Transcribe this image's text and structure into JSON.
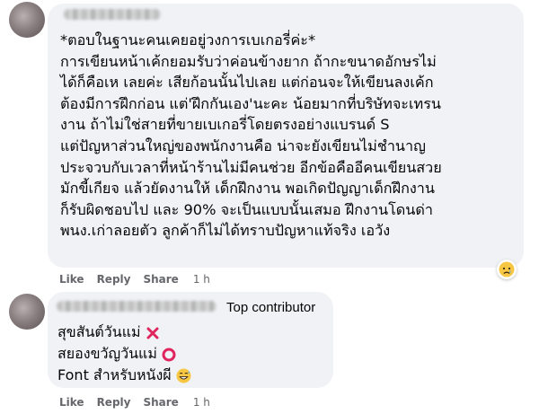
{
  "comment1": {
    "text_lines": [
      "*ตอบในฐานะคนเคยอยู่วงการเบเกอรี่ค่ะ*",
      "การเขียนหน้าเค้กยอมรับว่าค่อนข้างยาก ถ้ากะขนาดอักษรไม่",
      "ได้ก็คือเห เลยค่ะ เสียก้อนนั้นไปเลย แต่ก่อนจะให้เขียนลงเค้ก",
      "ต้องมีการฝึกก่อน แต่'ฝึกกันเอง'นะคะ น้อยมากที่บริษัทจะเทรน",
      "งาน ถ้าไม่ใช่สายที่ขายเบเกอรี่โดยตรงอย่างแบรนด์ S",
      "แต่ปัญหาส่วนใหญ่ของพนักงานคือ น่าจะยังเขียนไม่ชำนาญ",
      "ประจวบกับเวลาที่หน้าร้านไม่มีคนช่วย อีกข้อคืออีคนเขียนสวย",
      "มักขี้เกียจ แล้วยัดงานให้ เด็กฝึกงาน พอเกิดปัญญาเด็กฝึกงาน",
      "ก็รับผิดชอบไป และ 90% จะเป็นแบบนั้นเสมอ ฝึกงานโดนด่า",
      "พนง.เก่าลอยตัว ลูกค้าก็ไม่ได้ทราบปัญหาแท้จริง เอวัง"
    ],
    "actions": {
      "like": "Like",
      "reply": "Reply",
      "share": "Share",
      "time": "1 h"
    },
    "reaction_icon": "sad-crying-emoji"
  },
  "comment2": {
    "badge": "Top contributor",
    "lines": [
      {
        "text": "สุขสันต์วันแม่",
        "icon": "red-x-mark",
        "color": "#e0245e"
      },
      {
        "text": "สยองขวัญวันแม่",
        "icon": "red-circle",
        "color": "#e0245e"
      },
      {
        "text": "Font สำหรับหนังผี",
        "icon": "grinning-sweat-emoji",
        "color": "#f7c744"
      }
    ],
    "actions": {
      "like": "Like",
      "reply": "Reply",
      "share": "Share",
      "time": "1 h"
    }
  }
}
